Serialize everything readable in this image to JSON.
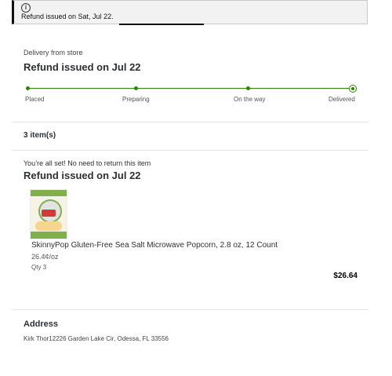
{
  "banner": {
    "icon": "info-icon",
    "message": "Refund issued on Sat, Jul 22."
  },
  "status": {
    "delivery_label": "Delivery from store",
    "title": "Refund issued on Jul 22"
  },
  "tracker": {
    "color": "#2a8703",
    "steps": [
      {
        "label": "Placed"
      },
      {
        "label": "Preparing"
      },
      {
        "label": "On the way"
      },
      {
        "label": "Delivered"
      }
    ]
  },
  "items": {
    "count_label": "3 item(s)",
    "return_note": "You’re all set! No need to return this item",
    "refund_title": "Refund issued on Jul 22",
    "product": {
      "name": "SkinnyPop Gluten-Free Sea Salt Microwave Popcorn, 2.8 oz, 12 Count",
      "unit_price": "26.4¢/oz",
      "qty": "Qty 3",
      "total": "$26.64"
    }
  },
  "address": {
    "title": "Address",
    "text": "Kirk Thor12226 Garden Lake Cir, Odessa, FL 33556"
  }
}
